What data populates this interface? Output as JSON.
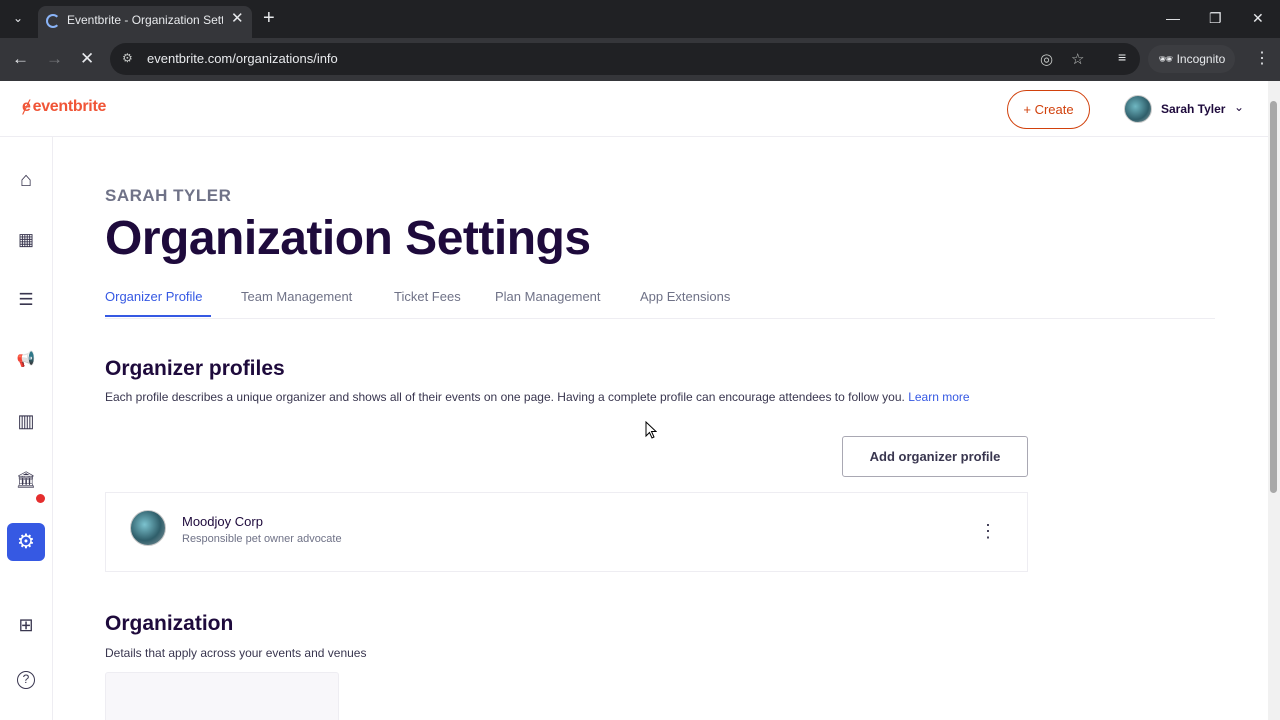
{
  "browser": {
    "tab_title": "Eventbrite - Organization Settings",
    "new_tab": "+",
    "tab_close": "✕",
    "url": "eventbrite.com/organizations/info",
    "incognito_label": "Incognito",
    "window": {
      "minimize": "—",
      "restore": "❐",
      "close": "✕"
    }
  },
  "header": {
    "logo_text": "eventbrite",
    "create_label": "+ Create",
    "user_name": "Sarah Tyler"
  },
  "sidebar": {
    "items": [
      {
        "name": "home",
        "icon": "⌂"
      },
      {
        "name": "events",
        "icon": "▦"
      },
      {
        "name": "orders",
        "icon": "☰"
      },
      {
        "name": "marketing",
        "icon": "📢"
      },
      {
        "name": "reporting",
        "icon": "▥"
      },
      {
        "name": "finance",
        "icon": "🏛"
      },
      {
        "name": "settings",
        "icon": "⚙"
      },
      {
        "name": "apps",
        "icon": "⊞"
      },
      {
        "name": "help",
        "icon": "?"
      }
    ]
  },
  "main": {
    "eyebrow": "SARAH TYLER",
    "title": "Organization Settings",
    "tabs": [
      {
        "label": "Organizer Profile",
        "active": true
      },
      {
        "label": "Team Management",
        "active": false
      },
      {
        "label": "Ticket Fees",
        "active": false
      },
      {
        "label": "Plan Management",
        "active": false
      },
      {
        "label": "App Extensions",
        "active": false
      }
    ],
    "organizer_profiles": {
      "heading": "Organizer profiles",
      "description": "Each profile describes a unique organizer and shows all of their events on one page. Having a complete profile can encourage attendees to follow you.",
      "learn_more": "Learn more",
      "add_button": "Add organizer profile",
      "profiles": [
        {
          "name": "Moodjoy Corp",
          "tagline": "Responsible pet owner advocate"
        }
      ]
    },
    "organization": {
      "heading": "Organization",
      "description": "Details that apply across your events and venues"
    }
  },
  "colors": {
    "brand": "#f05537",
    "accent": "#3659e3",
    "heading": "#1e0a3c"
  }
}
